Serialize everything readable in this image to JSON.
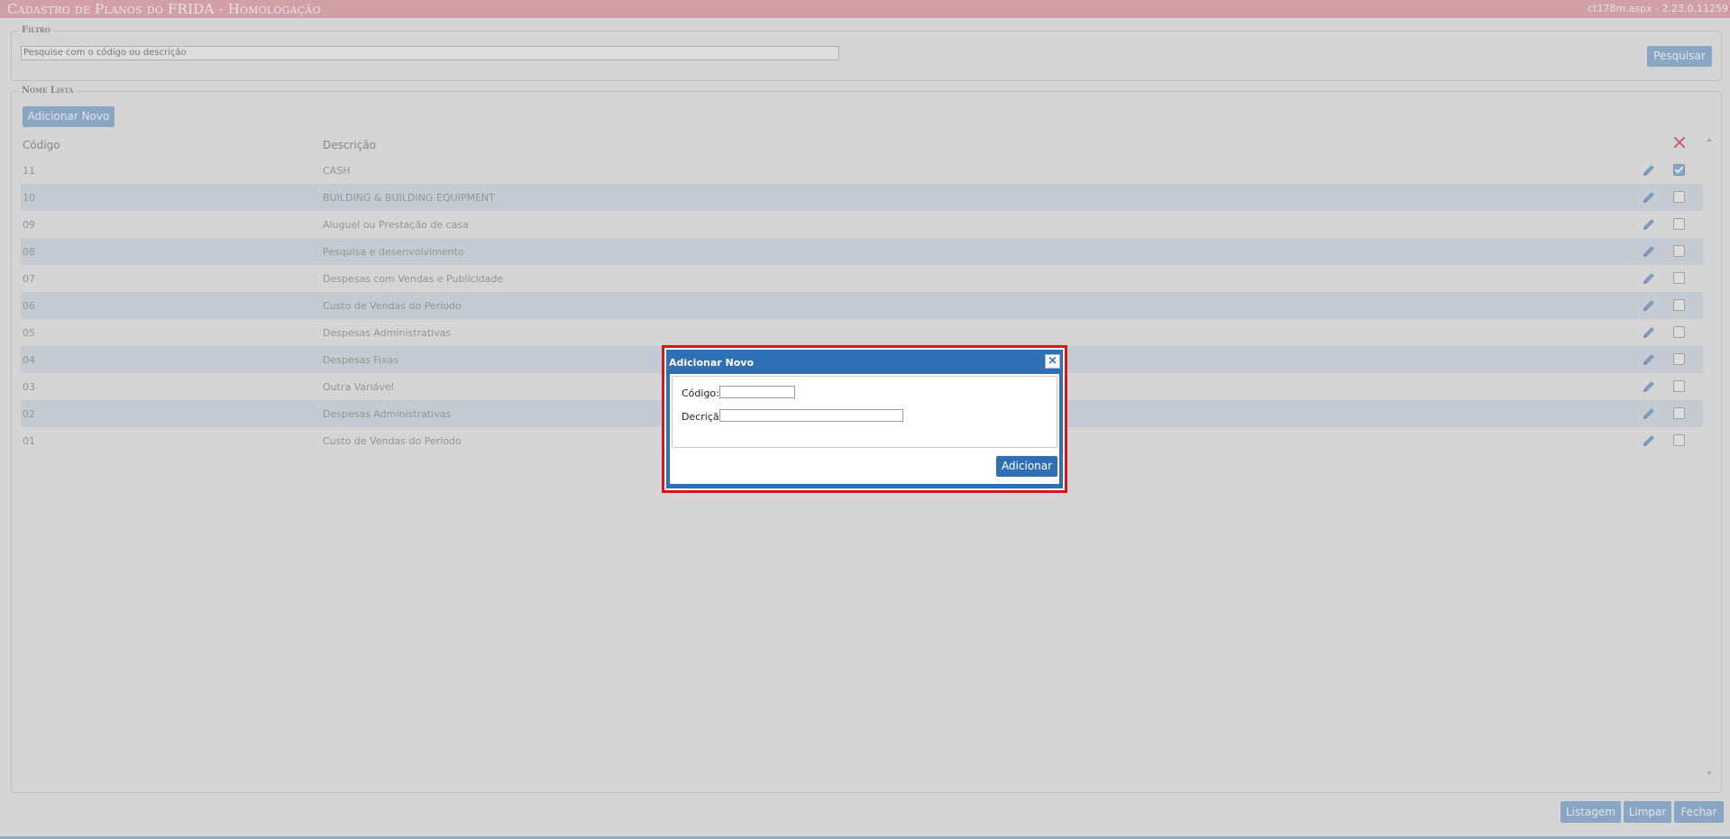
{
  "header": {
    "title": "Cadastro de Planos do FRIDA  - Homologação",
    "version": "ct178m.aspx - 2.23.0.11259"
  },
  "filter": {
    "legend": "Filtro",
    "search_placeholder": "Pesquise com o código ou descrição",
    "search_button": "Pesquisar"
  },
  "list": {
    "legend": "Nome Lista",
    "add_button": "Adicionar Novo",
    "columns": {
      "code": "Código",
      "description": "Descrição"
    },
    "rows": [
      {
        "code": "11",
        "description": "CASH",
        "checked": true
      },
      {
        "code": "10",
        "description": "BUILDING & BUILDING EQUIPMENT",
        "checked": false
      },
      {
        "code": "09",
        "description": "Aluguel ou Prestação de casa",
        "checked": false
      },
      {
        "code": "08",
        "description": "Pesquisa e desenvolvimento",
        "checked": false
      },
      {
        "code": "07",
        "description": "Despesas com Vendas e Publicidade",
        "checked": false
      },
      {
        "code": "06",
        "description": "Custo de Vendas do Período",
        "checked": false
      },
      {
        "code": "05",
        "description": "Despesas Administrativas",
        "checked": false
      },
      {
        "code": "04",
        "description": "Despesas Fixas",
        "checked": false
      },
      {
        "code": "03",
        "description": "Outra Variável",
        "checked": false
      },
      {
        "code": "02",
        "description": "Despesas Administrativas",
        "checked": false
      },
      {
        "code": "01",
        "description": "Custo de Vendas do Período",
        "checked": false
      }
    ]
  },
  "modal": {
    "title": "Adicionar Novo",
    "code_label": "Código:",
    "code_value": "",
    "description_label": "Decrição:",
    "description_value": "",
    "submit_button": "Adicionar",
    "close_glyph": "×"
  },
  "footer": {
    "listagem_button": "Listagem",
    "limpar_button": "Limpar",
    "fechar_button": "Fechar"
  },
  "colors": {
    "title_bar": "#e9a7b0",
    "accent": "#2f6fb4",
    "muted_button": "#8bb1d8",
    "highlight_border": "#d9141f",
    "row_alt": "#d6dfe8",
    "delete_icon": "#e05555"
  }
}
